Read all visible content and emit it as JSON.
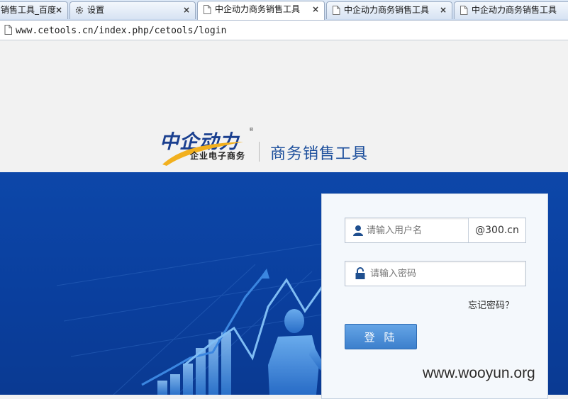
{
  "browser": {
    "tabs": [
      {
        "label": "销售工具_百度",
        "icon": "none",
        "active": false
      },
      {
        "label": "设置",
        "icon": "gear-icon",
        "active": false
      },
      {
        "label": "中企动力商务销售工具",
        "icon": "page-icon",
        "active": true
      },
      {
        "label": "中企动力商务销售工具",
        "icon": "page-icon",
        "active": false
      },
      {
        "label": "中企动力商务销售工具",
        "icon": "page-icon",
        "active": false
      }
    ],
    "close_glyph": "×",
    "address": "www.cetools.cn/index.php/cetools/login"
  },
  "header": {
    "brand_script": "中企动力",
    "brand_sub": "企业电子商务",
    "reg_mark": "®",
    "app_title": "商务销售工具"
  },
  "login": {
    "username_placeholder": "请输入用户名",
    "domain_suffix": "@300.cn",
    "password_placeholder": "请输入密码",
    "forgot_label": "忘记密码？",
    "submit_label": "登 陆"
  },
  "watermark": "www.wooyun.org",
  "colors": {
    "hero_blue": "#0d47a9",
    "title_blue": "#1d4f9c",
    "button_blue": "#3c7fcc"
  }
}
